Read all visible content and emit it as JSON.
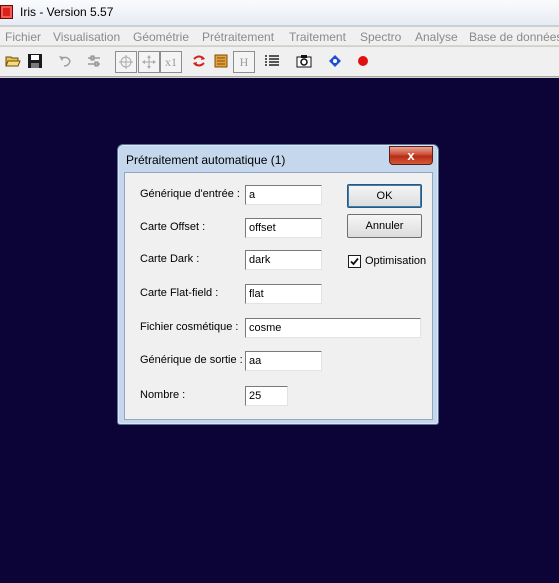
{
  "window": {
    "title": "Iris - Version 5.57"
  },
  "menu": {
    "items": [
      "Fichier",
      "Visualisation",
      "Géométrie",
      "Prétraitement",
      "Traitement",
      "Spectro",
      "Analyse",
      "Base de données"
    ]
  },
  "toolbar": {
    "buttons": [
      {
        "name": "open-folder-icon"
      },
      {
        "name": "save-icon"
      },
      {
        "name": "undo-icon"
      },
      {
        "name": "adjust-sliders-icon"
      },
      {
        "name": "crosshair-icon"
      },
      {
        "name": "move-icon"
      },
      {
        "name": "zoom-x1-icon",
        "glyph": "x1"
      },
      {
        "name": "red-arrows-icon"
      },
      {
        "name": "document-icon"
      },
      {
        "name": "histogram-icon",
        "glyph": "H"
      },
      {
        "name": "list-icon"
      },
      {
        "name": "camera-icon"
      },
      {
        "name": "blue-dots-icon"
      },
      {
        "name": "record-icon"
      }
    ]
  },
  "dialog": {
    "title": "Prétraitement automatique (1)",
    "close_label": "x",
    "fields": {
      "generic_input": {
        "label": "Générique d'entrée :",
        "value": "a"
      },
      "offset": {
        "label": "Carte Offset :",
        "value": "offset"
      },
      "dark": {
        "label": "Carte Dark :",
        "value": "dark"
      },
      "flat": {
        "label": "Carte Flat-field :",
        "value": "flat"
      },
      "cosmetic": {
        "label": "Fichier cosmétique :",
        "value": "cosme"
      },
      "generic_output": {
        "label": "Générique de sortie :",
        "value": "aa"
      },
      "number": {
        "label": "Nombre :",
        "value": "25"
      }
    },
    "ok_label": "OK",
    "cancel_label": "Annuler",
    "optimisation": {
      "label": "Optimisation",
      "checked": true
    }
  },
  "colors": {
    "workspace": "#0c0437",
    "dialog_frame": "#c5d7ec",
    "close_button": "#c8432c"
  }
}
